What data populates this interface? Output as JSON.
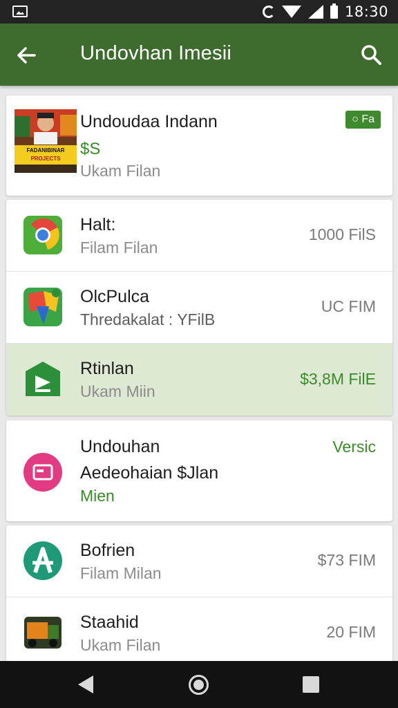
{
  "status_bar": {
    "time": "18:30"
  },
  "app_bar": {
    "title": "Undovhan Imesii",
    "back_icon": "arrow-left-icon",
    "search_icon": "search-icon"
  },
  "featured": {
    "name": "Undoudaa Indann",
    "price": "$S",
    "sub": "Ukam Filan",
    "badge": "○ Fa",
    "thumb_text": [
      "FADANIBINAR",
      "PROJECTS"
    ]
  },
  "list1": [
    {
      "name": "Halt:",
      "sub": "Filam Filan",
      "size": "1000 FilS",
      "icon": "chrome-icon"
    },
    {
      "name": "OlcPulca",
      "sub": "Thredakalat : YFilB",
      "size": "UC FIM",
      "icon": "maps-icon"
    },
    {
      "name": "Rtinlan",
      "sub": "Ukam Miin",
      "size": "$3,8M FilE",
      "icon": "play-icon"
    }
  ],
  "big_item": {
    "name": "Undouhan",
    "sub": "Aedeohaian $Jlan",
    "tag": "Mien",
    "version": "Versic",
    "icon": "pink-square-icon"
  },
  "list2": [
    {
      "name": "Bofrien",
      "sub": "Filam Milan",
      "size": "$73 FIM",
      "icon": "letter-a-icon"
    },
    {
      "name": "Staahid",
      "sub": "Ukam Filan",
      "size": "20 FIM",
      "icon": "truck-icon"
    }
  ],
  "colors": {
    "appbar": "#3e6b2e",
    "accent": "#3a8a2a",
    "highlight": "#dde9d3"
  }
}
